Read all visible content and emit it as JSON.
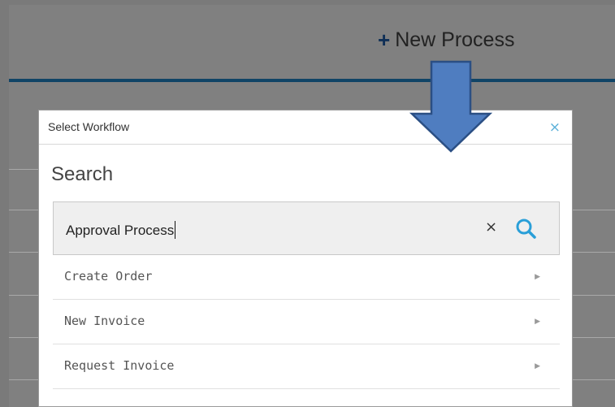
{
  "header": {
    "new_process_label": "New Process",
    "plus_glyph": "+"
  },
  "modal": {
    "title": "Select Workflow",
    "close_glyph": "×",
    "search_heading": "Search",
    "search_value": "Approval Process",
    "clear_glyph": "×",
    "items": [
      {
        "label": "Create Order",
        "chevron": "▶"
      },
      {
        "label": "New Invoice",
        "chevron": "▶"
      },
      {
        "label": "Request Invoice",
        "chevron": "▶"
      }
    ]
  },
  "colors": {
    "accent_blue": "#5ab0d8",
    "arrow_fill": "#4f7dc0",
    "arrow_stroke": "#2b4f84",
    "topbar_line": "#104466",
    "overlay": "#808080"
  },
  "icons": {
    "close": "close-icon",
    "clear": "clear-icon",
    "search": "search-icon",
    "chevron": "chevron-right-icon",
    "plus": "plus-icon"
  }
}
